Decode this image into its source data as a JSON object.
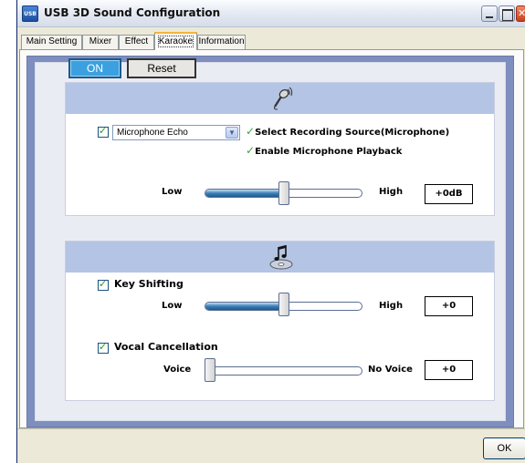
{
  "window": {
    "title": "USB 3D Sound Configuration",
    "app_icon_text": "USB"
  },
  "tabs": [
    {
      "label": "Main Setting",
      "active": false
    },
    {
      "label": "Mixer",
      "active": false
    },
    {
      "label": "Effect",
      "active": false
    },
    {
      "label": "Karaoke",
      "active": true
    },
    {
      "label": "Information",
      "active": false
    }
  ],
  "toolbar": {
    "on_label": "ON",
    "reset_label": "Reset"
  },
  "microphone_group": {
    "icon": "microphone-icon",
    "enabled": true,
    "effect_select": {
      "value": "Microphone Echo"
    },
    "select_source_label": "Select Recording Source(Microphone)",
    "enable_playback_label": "Enable Microphone Playback",
    "check_glyph": "✓",
    "slider": {
      "min_label": "Low",
      "max_label": "High",
      "value_text": "+0dB",
      "level_fraction": 0.5
    }
  },
  "music_group": {
    "icon": "music-disc-icon",
    "key_shifting": {
      "enabled": true,
      "label": "Key Shifting",
      "slider": {
        "min_label": "Low",
        "max_label": "High",
        "value_text": "+0",
        "level_fraction": 0.5
      }
    },
    "vocal_cancellation": {
      "enabled": true,
      "label": "Vocal Cancellation",
      "slider": {
        "min_label": "Voice",
        "max_label": "No Voice",
        "value_text": "+0",
        "level_fraction": 0.0
      }
    }
  },
  "footer": {
    "ok_label": "OK"
  },
  "colors": {
    "on_button": "#3aa0e0",
    "group_header": "#b4c4e4",
    "canvas": "#7e8ebf",
    "slider_fill": "#3c7fb7",
    "check_green": "#3aa33a"
  }
}
